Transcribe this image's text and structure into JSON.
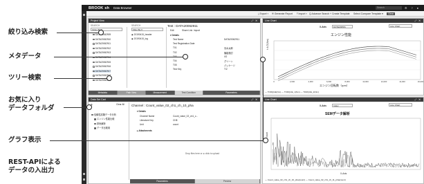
{
  "annotations": [
    {
      "id": "filter",
      "label": "絞り込み検索"
    },
    {
      "id": "meta",
      "label": "メタデータ"
    },
    {
      "id": "tree",
      "label": "ツリー検索"
    },
    {
      "id": "fav",
      "label": "お気に入り\nデータフォルダ"
    },
    {
      "id": "graph",
      "label": "グラフ表示"
    },
    {
      "id": "rest",
      "label": "REST-APIによる\nデータの入出力"
    }
  ],
  "app": {
    "logo": "BROOK sh",
    "title": "Data Browser",
    "search_placeholder": "Search",
    "top_icons": "⚙ ? ● ▾",
    "toolbar": {
      "export": "⤓ Export ▾",
      "report": "🗎 Generate Report",
      "import": "⤒ Import ▾",
      "advanced": "Q Advance Search",
      "create_template": "+ Create Template",
      "select_template": "Select Compare Template ▾",
      "clear": "Clear"
    },
    "project_view": {
      "header": "Project View",
      "order_label": "Order By ▾",
      "filter_label": "Filter By ▾",
      "search_label": "SEARCH",
      "search_label2": "SEARCH",
      "files": [
        "DATA20062909",
        "DATA20062910",
        "DATA20062911",
        "DATA20062912",
        "DATA20062913",
        "DATA20062914",
        "DATA20062915",
        "DATA20062916",
        "DATA20062917",
        "DATA20062918",
        "DATA20062919"
      ],
      "highlight_index": 8,
      "filter_results": [
        "◉ 20190415_header",
        "◉ 20190415_log"
      ],
      "tabs": [
        "Metadata",
        "Path View",
        "Measurement",
        "Test Condition",
        "Parameters"
      ]
    },
    "metadata": {
      "title": "Test : DATA20062911",
      "buttons": [
        "Edit",
        "Share Link",
        "Import"
      ],
      "section": "▾ Details",
      "rows": [
        [
          "Test Name",
          "DATA20062911"
        ],
        [
          "Test Registration Date",
          ""
        ],
        [
          "T01",
          "清水太郎"
        ],
        [
          "T02",
          "機能検討"
        ],
        [
          "T03",
          "I/O"
        ],
        [
          "T04",
          "グリーン"
        ],
        [
          "T05",
          "パッケージ"
        ],
        [
          "Test Key",
          "T/2"
        ]
      ]
    },
    "line_chart_top": {
      "header": "Line Chart",
      "dropdown": "Line Chart",
      "xaxis_label": "X-Axis",
      "xaxis_value": "DATE20PM1",
      "title": "エンジン性能",
      "xlabel": "エンジン回転数（rpm）",
      "ylabel": "トルク(Nm)",
      "legend": "— TORQUE(Nm)  — TORQUE_1(Nm)  — TORQUE_2(Nm)",
      "xticks": [
        "0",
        "2,000",
        "4,000",
        "6,000",
        "8,000",
        "10,000",
        "12,000",
        "14,000",
        "16,000"
      ]
    },
    "data_set_cart": {
      "header": "Data Set Cart",
      "clear_all": "Clear All",
      "items": [
        "信頼性試験データ分析",
        "エンジン性能比較",
        "排気解析",
        "データ比較用"
      ]
    },
    "channel": {
      "title": "Channel : Count_value_02_ch1_ch_10_pha",
      "section": "▾ Details",
      "rows": [
        [
          "Channel Name",
          "Count_value_02_ch1_c..."
        ],
        [
          "Literature Key",
          "CH8"
        ],
        [
          "Unit",
          "count"
        ]
      ],
      "section2": "▸ Attachments",
      "dropzone": "Drop files here or  ⊕ click to upload",
      "tabs": [
        "Parameters",
        "Preview"
      ]
    },
    "line_chart_bottom": {
      "header": "Line Chart",
      "dropdown": "Line Chart",
      "xaxis_label": "X-Axis",
      "xaxis_value": "Index",
      "title": "SEMデータ解析",
      "xlabel": "X-Axis",
      "ylabel": "count",
      "legend": "— Count_value_02_ch1_ch_10_pha(count)  — Count_value_02_ch1_ch_11_pha(count)"
    }
  }
}
